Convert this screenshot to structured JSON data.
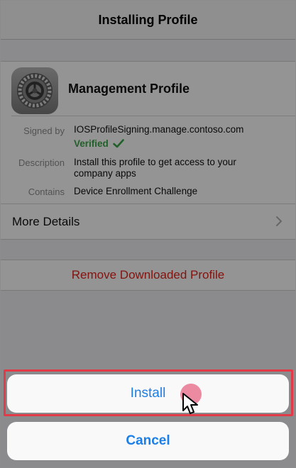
{
  "nav": {
    "title": "Installing Profile"
  },
  "profile": {
    "name": "Management Profile",
    "icon": "settings-gear-icon",
    "signed_by_label": "Signed by",
    "signed_by_value": "IOSProfileSigning.manage.contoso.com",
    "verified_label": "Verified",
    "description_label": "Description",
    "description_line1": "Install this profile to get access to your",
    "description_line2": "company apps",
    "contains_label": "Contains",
    "contains_value": "Device Enrollment Challenge"
  },
  "more_details": {
    "label": "More Details"
  },
  "remove": {
    "label": "Remove Downloaded Profile"
  },
  "sheet": {
    "install_label": "Install",
    "cancel_label": "Cancel"
  },
  "colors": {
    "accent_blue": "#1a7fe8",
    "destructive_red": "#e0251b",
    "verified_green": "#3aa648",
    "highlight_red": "#e23b47"
  }
}
